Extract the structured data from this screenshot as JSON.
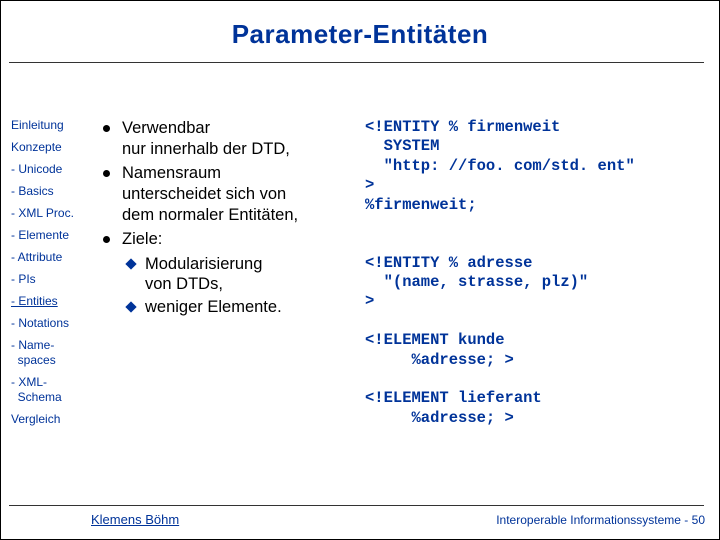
{
  "title": "Parameter-Entitäten",
  "sidebar": {
    "items": [
      "Einleitung",
      "Konzepte",
      "- Unicode",
      "- Basics",
      "- XML Proc.",
      "- Elemente",
      "- Attribute",
      "- PIs",
      "- Entities",
      "- Notations",
      "- Name-\n  spaces",
      "- XML-\n  Schema",
      "Vergleich"
    ]
  },
  "bullets": [
    {
      "text": "Verwendbar\nnur innerhalb der DTD,"
    },
    {
      "text": "Namensraum\nunterscheidet sich von\ndem normaler Entitäten,"
    },
    {
      "text": "Ziele:",
      "sub": [
        "Modularisierung\nvon DTDs,",
        "weniger Elemente."
      ]
    }
  ],
  "code": "<!ENTITY % firmenweit\n  SYSTEM\n  \"http: //foo. com/std. ent\"\n>\n%firmenweit;\n\n\n<!ENTITY % adresse\n  \"(name, strasse, plz)\"\n>\n\n<!ELEMENT kunde\n     %adresse; >\n\n<!ELEMENT lieferant\n     %adresse; >",
  "footer": {
    "author": "Klemens Böhm",
    "pager": "Interoperable Informationssysteme - 50"
  }
}
